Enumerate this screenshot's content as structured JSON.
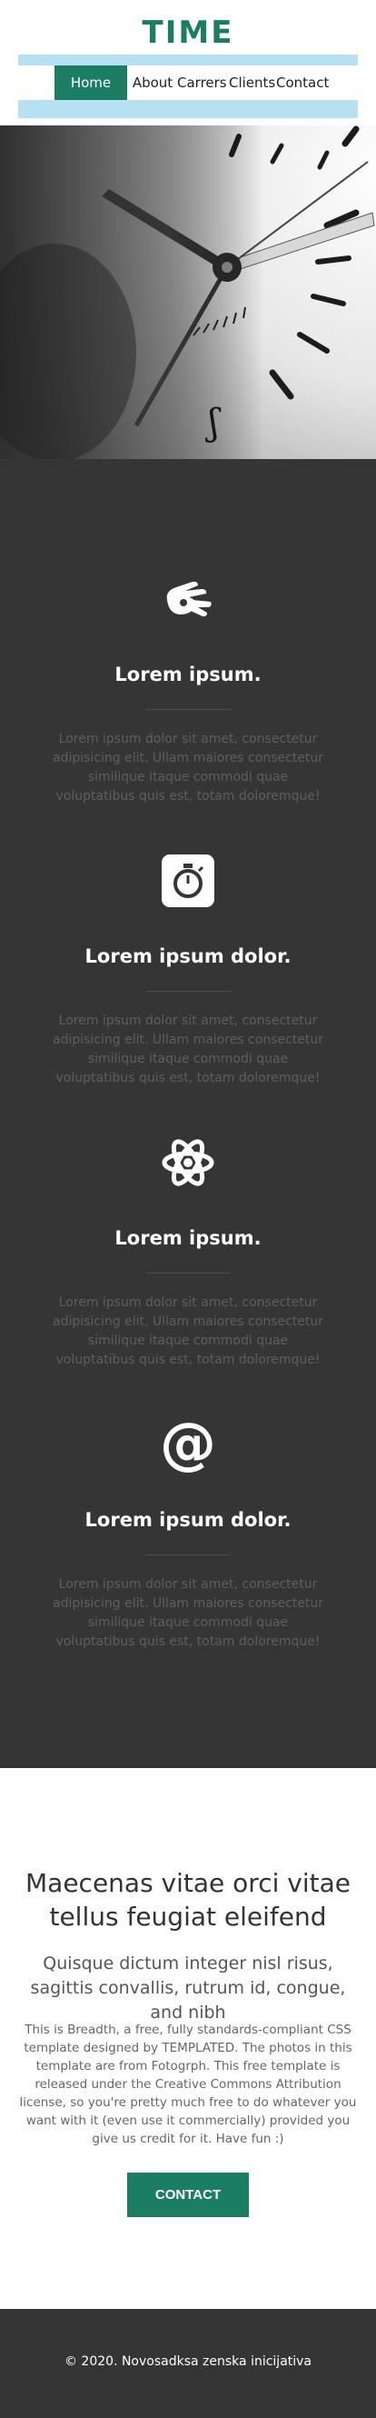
{
  "header": {
    "logo": "TIME",
    "nav": [
      {
        "label": "Home",
        "active": true
      },
      {
        "label": "About",
        "active": false
      },
      {
        "label": "Carrers",
        "active": false
      },
      {
        "label": "Clients",
        "active": false
      },
      {
        "label": "Contact",
        "active": false
      }
    ]
  },
  "hero": {
    "image": "black-and-white-clock-face-closeup"
  },
  "features": [
    {
      "icon": "sign-language-hands-icon",
      "title": "Lorem ipsum.",
      "text": "Lorem ipsum dolor sit amet, consectetur adipisicing elit. Ullam maiores consectetur similique itaque commodi quae voluptatibus quis est, totam doloremque!"
    },
    {
      "icon": "stopwatch-icon",
      "title": "Lorem ipsum dolor.",
      "text": "Lorem ipsum dolor sit amet, consectetur adipisicing elit. Ullam maiores consectetur similique itaque commodi quae voluptatibus quis est, totam doloremque!"
    },
    {
      "icon": "atom-icon",
      "title": "Lorem ipsum.",
      "text": "Lorem ipsum dolor sit amet, consectetur adipisicing elit. Ullam maiores consectetur similique itaque commodi quae voluptatibus quis est, totam doloremque!"
    },
    {
      "icon": "at-sign-icon",
      "title": "Lorem ipsum dolor.",
      "text": "Lorem ipsum dolor sit amet, consectetur adipisicing elit. Ullam maiores consectetur similique itaque commodi quae voluptatibus quis est, totam doloremque!"
    }
  ],
  "cta": {
    "title": "Maecenas vitae orci vitae tellus feugiat eleifend",
    "subtitle": "Quisque dictum integer nisl risus, sagittis convallis, rutrum id, congue, and nibh",
    "body": "This is Breadth, a free, fully standards-compliant CSS template designed by TEMPLATED. The photos in this template are from Fotogrph. This free template is released under the Creative Commons Attribution license, so you're pretty much free to do whatever you want with it (even use it commercially) provided you give us credit for it. Have fun :)",
    "button": "CONTACT"
  },
  "footer": {
    "text": "© 2020. Novosadksa zenska inicijativa"
  },
  "colors": {
    "accent": "#1b7e62",
    "nav_band": "#b8e0f3",
    "dark": "#353535"
  }
}
